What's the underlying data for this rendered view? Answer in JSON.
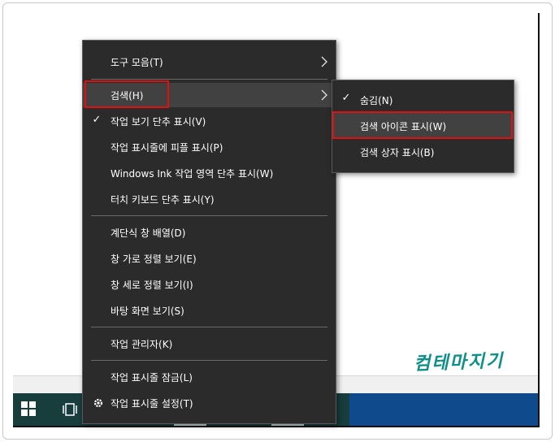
{
  "context_menu": {
    "items": [
      {
        "label": "도구 모음(T)",
        "checked": false,
        "submenu": true
      },
      {
        "label": "검색(H)",
        "checked": false,
        "submenu": true,
        "highlighted": true
      },
      {
        "label": "작업 보기 단추 표시(V)",
        "checked": true
      },
      {
        "label": "작업 표시줄에 피플 표시(P)",
        "checked": false
      },
      {
        "label": "Windows Ink 작업 영역 단추 표시(W)",
        "checked": false
      },
      {
        "label": "터치 키보드 단추 표시(Y)",
        "checked": false
      },
      {
        "label": "계단식 창 배열(D)",
        "checked": false
      },
      {
        "label": "창 가로 정렬 보기(E)",
        "checked": false
      },
      {
        "label": "창 세로 정렬 보기(I)",
        "checked": false
      },
      {
        "label": "바탕 화면 보기(S)",
        "checked": false
      },
      {
        "label": "작업 관리자(K)",
        "checked": false
      },
      {
        "label": "작업 표시줄 잠금(L)",
        "checked": false
      },
      {
        "label": "작업 표시줄 설정(T)",
        "checked": false,
        "icon": "gear-icon"
      }
    ]
  },
  "search_submenu": {
    "items": [
      {
        "label": "숨김(N)",
        "checked": true
      },
      {
        "label": "검색 아이콘 표시(W)",
        "checked": false,
        "highlighted": true
      },
      {
        "label": "검색 상자 표시(B)",
        "checked": false
      }
    ]
  },
  "taskbar": {
    "start_icon": "windows-logo-icon",
    "taskview_icon": "task-view-icon"
  },
  "watermark": "컴테마지기",
  "colors": {
    "menu_bg": "#2b2b2b",
    "menu_highlight": "#414141",
    "taskbar": "#173d3d",
    "taskbar_right": "#0f4a8c",
    "annotation_red": "#e01010",
    "watermark": "#0c8f88"
  }
}
